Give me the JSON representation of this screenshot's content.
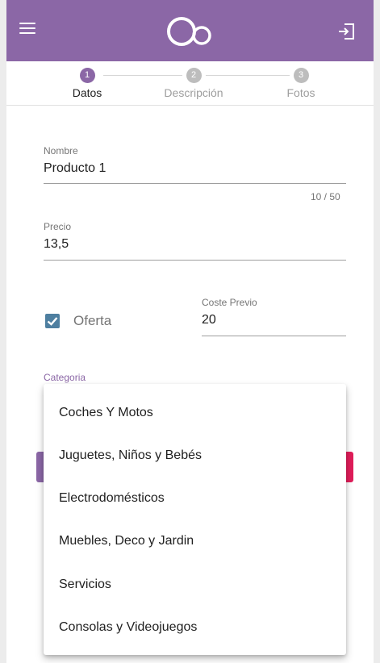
{
  "app": {
    "menu_icon": "menu-icon",
    "logo_icon": "bubbles-logo-icon",
    "logout_icon": "logout-icon",
    "brand_color": "#8b67a6"
  },
  "stepper": {
    "steps": [
      {
        "number": "1",
        "label": "Datos",
        "state": "active"
      },
      {
        "number": "2",
        "label": "Descripción",
        "state": "inactive"
      },
      {
        "number": "3",
        "label": "Fotos",
        "state": "inactive"
      }
    ]
  },
  "form": {
    "nombre": {
      "label": "Nombre",
      "value": "Producto 1",
      "counter": "10 / 50"
    },
    "precio": {
      "label": "Precio",
      "value": "13,5"
    },
    "oferta": {
      "label": "Oferta",
      "checked": true
    },
    "coste_previo": {
      "label": "Coste Previo",
      "value": "20"
    },
    "categoria": {
      "label": "Categoria"
    }
  },
  "dropdown": {
    "options": [
      "Coches Y Motos",
      "Juguetes, Niños y Bebés",
      "Electrodomésticos",
      "Muebles, Deco y Jardin",
      "Servicios",
      "Consolas y Videojuegos"
    ]
  },
  "colors": {
    "accent": "#8b67a6",
    "checkbox": "#4e7fa0",
    "danger_button": "#e11d5a"
  }
}
